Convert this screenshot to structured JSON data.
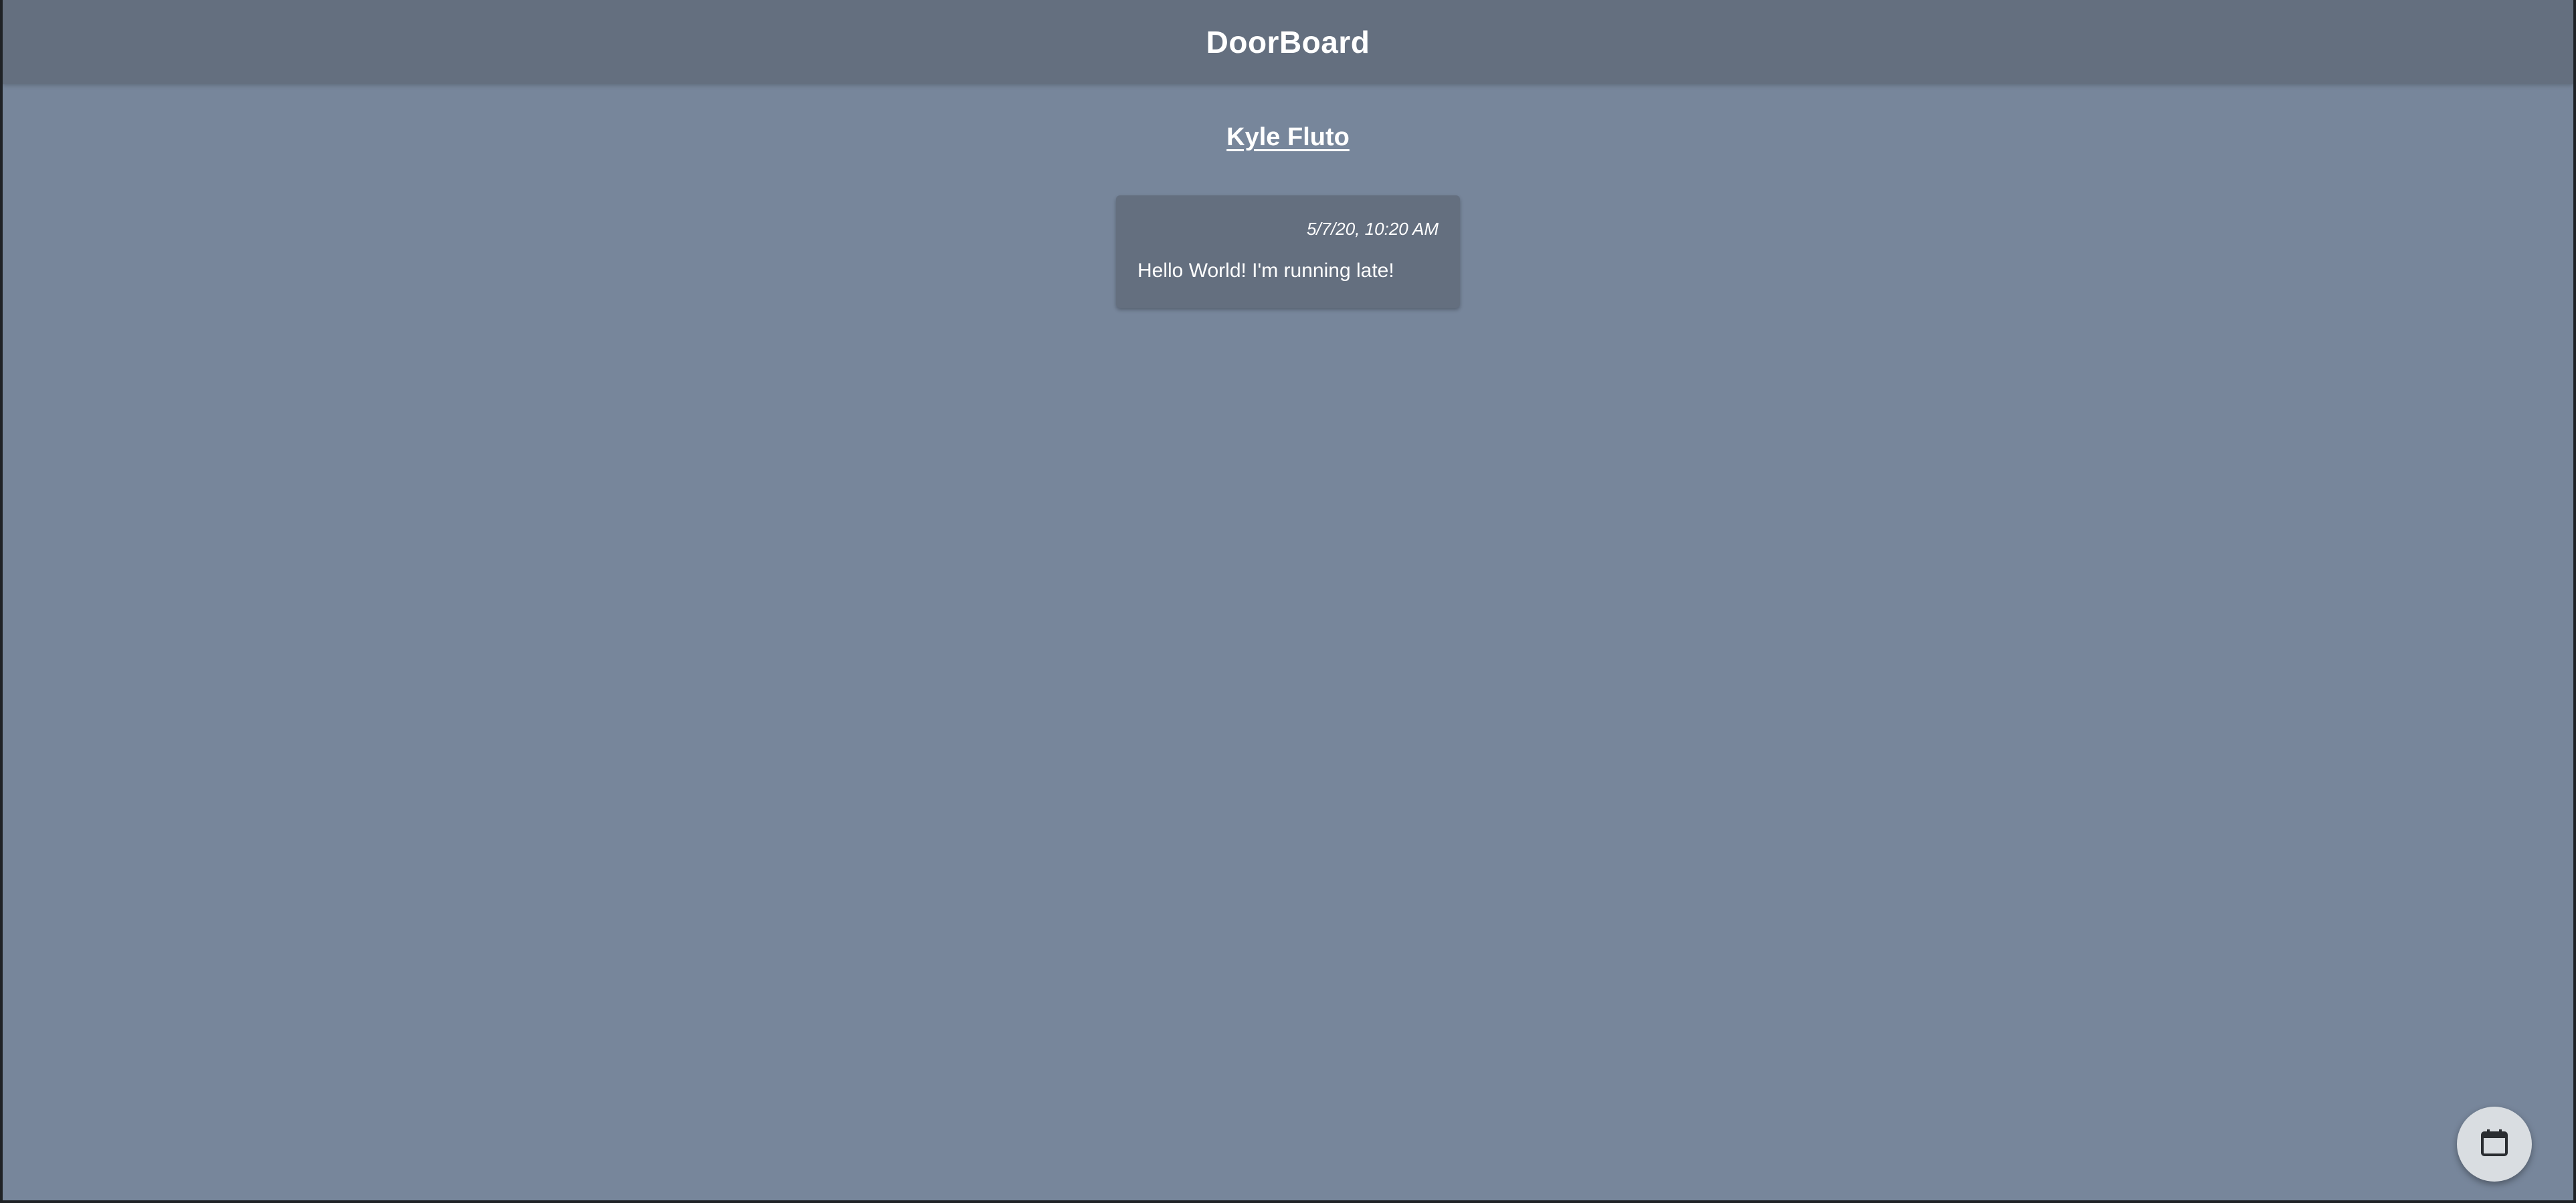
{
  "app": {
    "title": "DoorBoard"
  },
  "board": {
    "owner_name": "Kyle Fluto",
    "messages": [
      {
        "timestamp": "5/7/20, 10:20 AM",
        "text": "Hello World! I'm running late!"
      }
    ]
  },
  "fab": {
    "icon": "calendar-icon"
  },
  "colors": {
    "background": "#77869b",
    "header": "#646f7f",
    "card": "#646f7f",
    "fab": "#d9dde1",
    "text": "#ffffff"
  }
}
